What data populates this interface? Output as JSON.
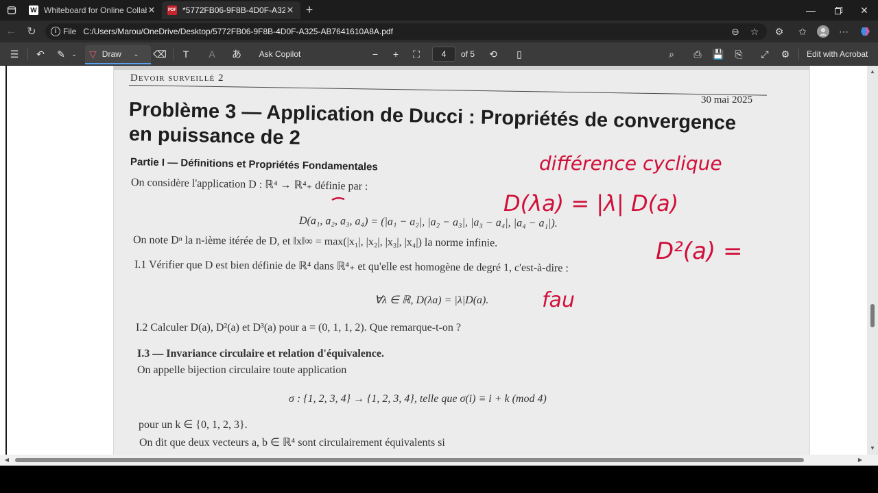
{
  "browser": {
    "tabs": [
      {
        "favicon": "W",
        "title": "Whiteboard for Online Collaboration",
        "active": false
      },
      {
        "favicon": "pdf",
        "title": "*5772FB06-9F8B-4D0F-A325-AB7641610A8A.pdf",
        "active": true
      }
    ],
    "address": {
      "scheme": "File",
      "url": "C:/Users/Marou/OneDrive/Desktop/5772FB06-9F8B-4D0F-A325-AB7641610A8A.pdf"
    }
  },
  "pdf_toolbar": {
    "draw_label": "Draw",
    "ask_copilot_label": "Ask Copilot",
    "page_current": "4",
    "page_total": "of 5",
    "edit_acrobat_label": "Edit with Acrobat"
  },
  "document": {
    "header": "Devoir surveillé 2",
    "date": "30 mai 2025",
    "title_line1": "Problème 3 — Application de Ducci : Propriétés de convergence",
    "title_line2": "en puissance de 2",
    "partie": "Partie I — Définitions et Propriétés Fondamentales",
    "intro": "On considère l'application D : ℝ⁴ → ℝ⁴₊ définie par :",
    "formula1": "D(a₁, a₂, a₃, a₄) = (|a₁ − a₂|, |a₂ − a₃|, |a₃ − a₄|, |a₄ − a₁|).",
    "norm_line": "On note Dⁿ la n-ième itérée de D, et ‖x‖∞ = max(|x₁|, |x₂|, |x₃|, |x₄|) la norme infinie.",
    "q11": "I.1 Vérifier que D est bien définie de ℝ⁴ dans ℝ⁴₊ et qu'elle est homogène de degré 1, c'est-à-dire :",
    "formula2": "∀λ ∈ ℝ,        D(λa) = |λ|D(a).",
    "q12": "I.2 Calculer D(a), D²(a) et D³(a) pour a = (0, 1, 1, 2). Que remarque-t-on ?",
    "q13": "I.3 — Invariance circulaire et relation d'équivalence.",
    "bijection": "On appelle bijection circulaire toute application",
    "formula3": "σ : {1, 2, 3, 4} → {1, 2, 3, 4},        telle que σ(i) ≡ i + k   (mod 4)",
    "k_line": "pour un k ∈ {0, 1, 2, 3}.",
    "equiv_line": "On dit que deux vecteurs a, b ∈ ℝ⁴ sont circulairement équivalents si"
  },
  "annotations": {
    "note1": "différence cyclique",
    "note2": "D(λa) = |λ| D(a)",
    "note3": "D²(a) =",
    "note4": "fau",
    "ink_color": "#d0103a"
  }
}
